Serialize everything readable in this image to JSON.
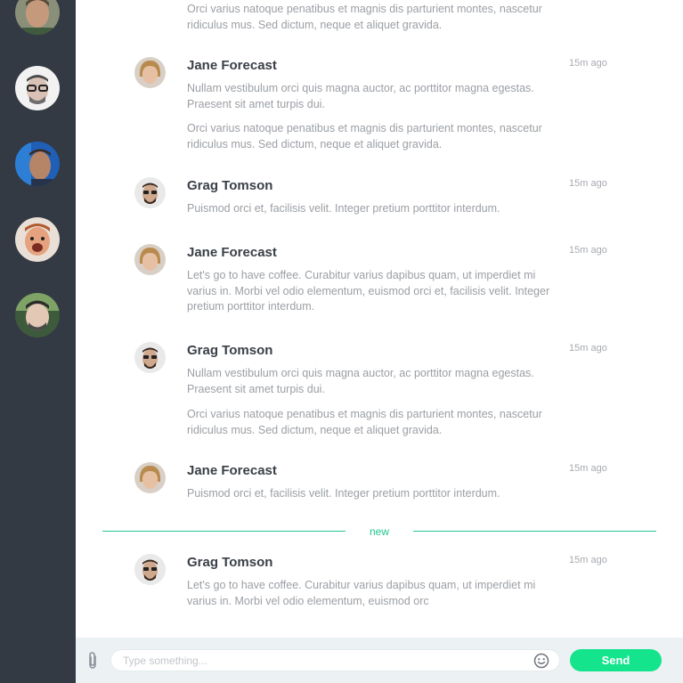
{
  "sidebar": {
    "contacts": [
      {
        "name": "contact-1"
      },
      {
        "name": "contact-2"
      },
      {
        "name": "contact-3"
      },
      {
        "name": "contact-4"
      },
      {
        "name": "contact-5"
      }
    ]
  },
  "chat": {
    "messages": [
      {
        "paragraphs": [
          "Orci varius natoque penatibus et magnis dis parturient montes, nascetur ridiculus mus. Sed dictum, neque et aliquet gravida."
        ]
      },
      {
        "author": "Jane Forecast",
        "time": "15m ago",
        "paragraphs": [
          "Nullam vestibulum orci quis magna auctor, ac porttitor magna egestas. Praesent sit amet turpis dui.",
          "Orci varius natoque penatibus et magnis dis parturient montes, nascetur ridiculus mus. Sed dictum, neque et aliquet gravida."
        ]
      },
      {
        "author": "Grag Tomson",
        "time": "15m ago",
        "paragraphs": [
          "Puismod orci et, facilisis velit. Integer pretium porttitor interdum."
        ]
      },
      {
        "author": "Jane Forecast",
        "time": "15m ago",
        "paragraphs": [
          "Let's go to have coffee. Curabitur varius dapibus quam, ut imperdiet mi varius in. Morbi vel odio elementum, euismod orci et, facilisis velit. Integer pretium porttitor interdum."
        ]
      },
      {
        "author": "Grag Tomson",
        "time": "15m ago",
        "paragraphs": [
          "Nullam vestibulum orci quis magna auctor, ac porttitor magna egestas. Praesent sit amet turpis dui.",
          "Orci varius natoque penatibus et magnis dis parturient montes, nascetur ridiculus mus. Sed dictum, neque et aliquet gravida."
        ]
      },
      {
        "author": "Jane Forecast",
        "time": "15m ago",
        "paragraphs": [
          "Puismod orci et, facilisis velit. Integer pretium porttitor interdum."
        ]
      },
      {
        "author": "Grag Tomson",
        "time": "15m ago",
        "paragraphs": [
          "Let's go to have coffee. Curabitur varius dapibus quam, ut imperdiet mi varius in. Morbi vel odio elementum, euismod orc"
        ]
      }
    ],
    "divider_label": "new"
  },
  "composer": {
    "placeholder": "Type something...",
    "send_label": "Send",
    "attach_icon": "paperclip-icon",
    "emoji_icon": "smiley-icon"
  },
  "colors": {
    "sidebar_bg": "#333a44",
    "accent_green": "#14e48c",
    "divider_green": "#26c59a",
    "composer_bg": "#ecf1f4"
  }
}
